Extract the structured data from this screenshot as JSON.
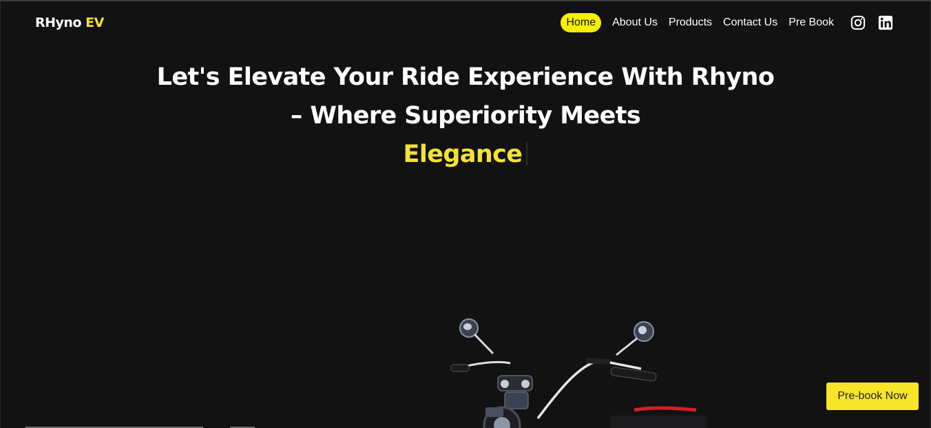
{
  "brand": {
    "name": "RHyno",
    "accent": "EV"
  },
  "nav": {
    "items": [
      {
        "label": "Home",
        "active": true
      },
      {
        "label": "About Us"
      },
      {
        "label": "Products"
      },
      {
        "label": "Contact Us"
      },
      {
        "label": "Pre Book"
      }
    ],
    "social_icons": [
      "instagram-icon",
      "linkedin-icon"
    ]
  },
  "hero": {
    "line1": "Let's Elevate Your Ride Experience With Rhyno",
    "line2": "– Where Superiority Meets",
    "accent_word": "Elegance"
  },
  "cta": {
    "prebook_label": "Pre-book Now"
  },
  "colors": {
    "background": "#121212",
    "accent_yellow": "#f5e232",
    "active_nav": "#f7f000",
    "text": "#ffffff"
  }
}
